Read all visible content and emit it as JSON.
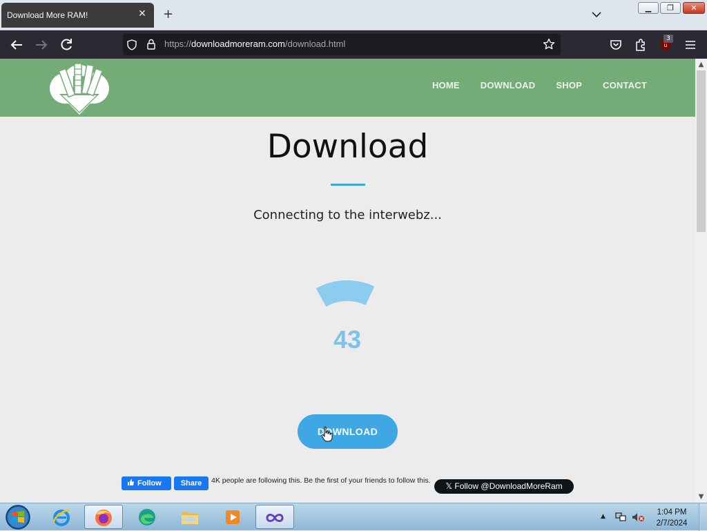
{
  "browser": {
    "tab_title": "Download More RAM!",
    "tab_close": "✕",
    "new_tab": "+",
    "url_scheme": "https://",
    "url_host": "downloadmoreram.com",
    "url_path": "/download.html",
    "ublock_count": "3"
  },
  "site": {
    "nav": [
      "HOME",
      "DOWNLOAD",
      "SHOP",
      "CONTACT"
    ],
    "page_title": "Download",
    "status_text": "Connecting to the interwebz...",
    "progress_value": "43",
    "progress_fraction": 0.43,
    "download_button": "DOWNLOAD",
    "colors": {
      "header": "#75ab76",
      "accent": "#3fa7e4",
      "progress": "#8cccee"
    }
  },
  "social": {
    "fb_follow": "Follow",
    "fb_share": "Share",
    "fb_text": "4K people are following this. Be the first of your friends to follow this.",
    "twitter_follow": "Follow @DownloadMoreRam"
  },
  "taskbar": {
    "time": "1:04 PM",
    "date": "2/7/2024",
    "apps": [
      "internet-explorer",
      "firefox",
      "edge",
      "file-explorer",
      "media-player",
      "visual-studio"
    ]
  }
}
